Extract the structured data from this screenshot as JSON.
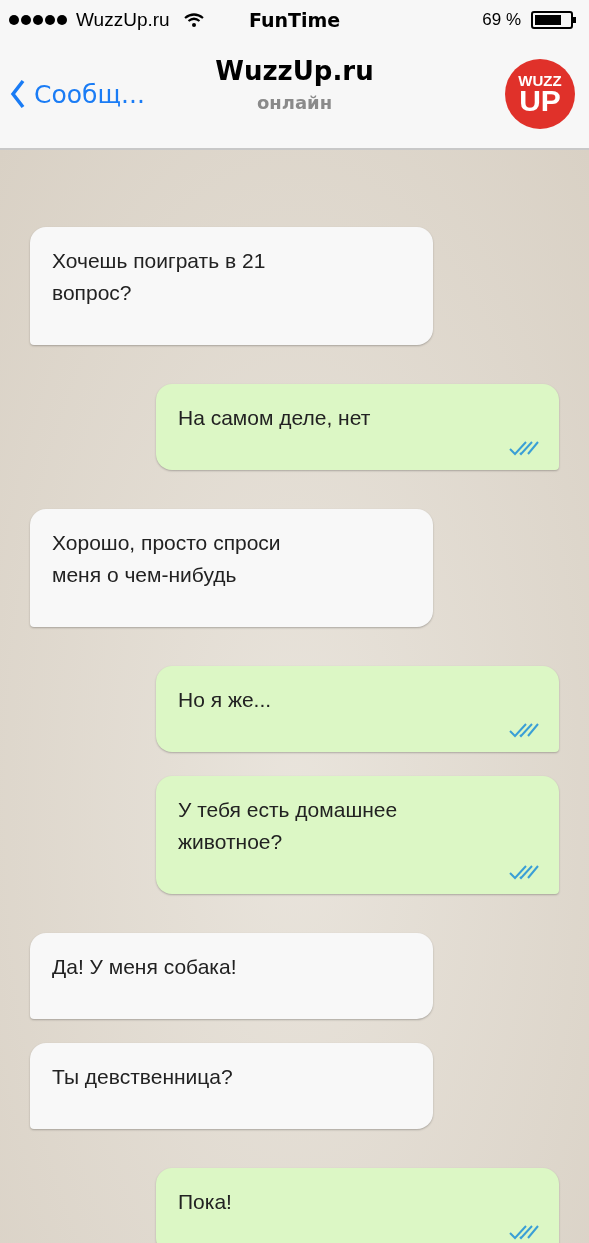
{
  "status_bar": {
    "carrier": "WuzzUp.ru",
    "title": "FunTime",
    "battery": "69 %"
  },
  "header": {
    "back": "Сообщ...",
    "title": "WuzzUp.ru",
    "subtitle": "онлайн",
    "logo": [
      "WUZZ",
      "UP"
    ]
  },
  "messages": [
    {
      "kind": "incoming",
      "text": "Хочешь поиграть в 21 вопрос?",
      "read": false
    },
    {
      "kind": "outgoing",
      "text": "На самом деле, нет",
      "read": true
    },
    {
      "kind": "incoming",
      "text": "Хорошо, просто спроси меня о чем-нибудь",
      "read": false
    },
    {
      "kind": "outgoing",
      "text": "Но я же...",
      "read": true
    },
    {
      "kind": "outgoing",
      "text": "У тебя есть домашнее животное?",
      "read": true
    },
    {
      "kind": "incoming",
      "text": "Да! У меня собака!",
      "read": false
    },
    {
      "kind": "incoming",
      "text": "Ты девственница?",
      "read": false
    },
    {
      "kind": "outgoing",
      "text": "Пока!",
      "read": true
    }
  ]
}
